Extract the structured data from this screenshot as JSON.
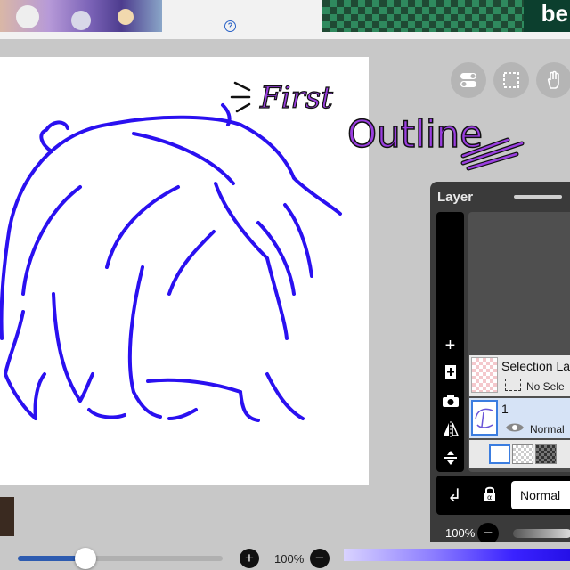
{
  "banner": {
    "help_icon": "?",
    "ad_text": "be"
  },
  "canvas": {
    "annotation_line1": "First",
    "annotation_line2": "Outline",
    "stroke_color": "#2a10f0",
    "annotation_color": "#9a3ee0"
  },
  "layer_panel": {
    "title": "Layer",
    "side_icons": [
      "plus-icon",
      "add-layer-icon",
      "camera-icon",
      "flip-icon",
      "merge-down-icon"
    ],
    "layers": [
      {
        "name": "Selection La",
        "status": "No Sele"
      },
      {
        "name": "1",
        "blend": "Normal"
      }
    ],
    "blend_mode": "Normal",
    "opacity": "100%"
  },
  "bottom_bar": {
    "brush_size_fraction": 0.33,
    "zoom": "100%"
  },
  "colors": {
    "panel_bg": "#3a3a3a",
    "selected_layer": "#d6e3f6",
    "brush_accent": "#2d5bb0"
  }
}
